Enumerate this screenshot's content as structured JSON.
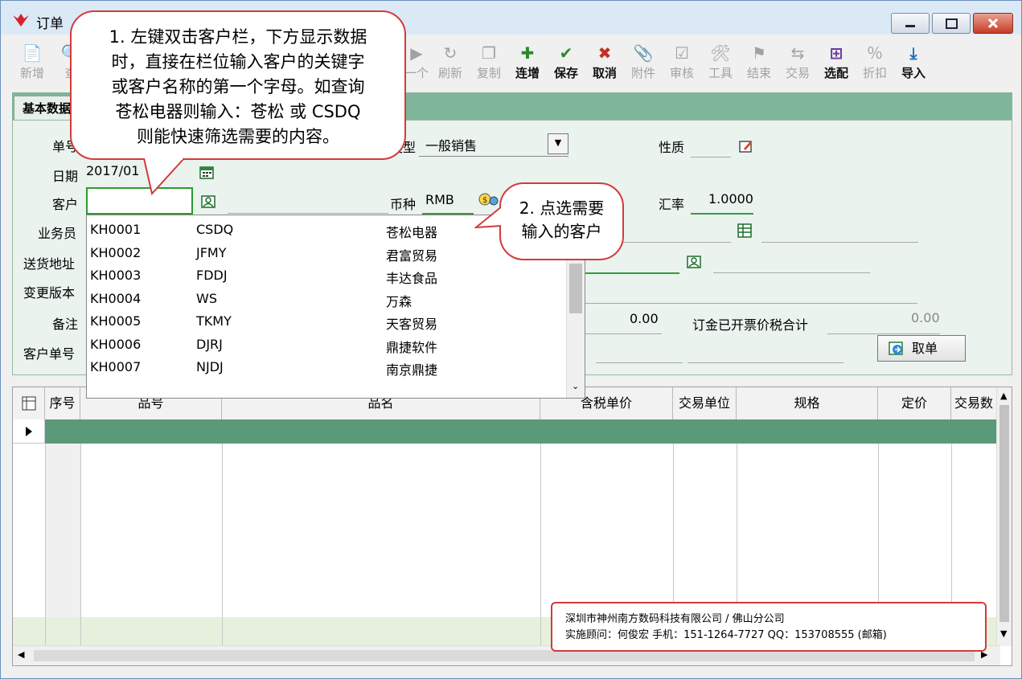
{
  "window": {
    "title": "订单"
  },
  "toolbar": [
    {
      "label": "新增",
      "icon": "📄",
      "enabled": false
    },
    {
      "label": "查",
      "icon": "🔍",
      "enabled": false
    },
    {
      "label": "一个",
      "icon": "▶",
      "enabled": false
    },
    {
      "label": "刷新",
      "icon": "↻",
      "enabled": false
    },
    {
      "label": "复制",
      "icon": "❐",
      "enabled": false
    },
    {
      "label": "连增",
      "icon": "✚",
      "enabled": true
    },
    {
      "label": "保存",
      "icon": "✔",
      "enabled": true
    },
    {
      "label": "取消",
      "icon": "✖",
      "enabled": true
    },
    {
      "label": "附件",
      "icon": "📎",
      "enabled": false
    },
    {
      "label": "审核",
      "icon": "☑",
      "enabled": false
    },
    {
      "label": "工具",
      "icon": "🛠",
      "enabled": false
    },
    {
      "label": "结束",
      "icon": "⚑",
      "enabled": false
    },
    {
      "label": "交易",
      "icon": "⇆",
      "enabled": false
    },
    {
      "label": "选配",
      "icon": "⊞",
      "enabled": true
    },
    {
      "label": "折扣",
      "icon": "％",
      "enabled": false
    },
    {
      "label": "导入",
      "icon": "⤓",
      "enabled": true
    }
  ],
  "tabs": [
    {
      "label": "基本数据"
    }
  ],
  "form": {
    "order_no_label": "单号",
    "date_label": "日期",
    "date_value": "2017/01",
    "customer_label": "客户",
    "customer_value": "",
    "salesman_label": "业务员",
    "address_label": "送货地址",
    "version_label": "变更版本",
    "remark_label": "备注",
    "cust_order_label": "客户单号",
    "type_label": "类型",
    "type_value": "一般销售",
    "nature_label": "性质",
    "currency_label": "币种",
    "currency_value": "RMB",
    "rate_label": "汇率",
    "rate_value": "1.0000",
    "amount_value": "0.00",
    "invoiced_label": "订金已开票价税合计",
    "invoiced_value": "0.00",
    "take_order_button": "取单"
  },
  "grid": {
    "columns": [
      "序号",
      "品号",
      "品名",
      "含税单价",
      "交易单位",
      "规格",
      "定价",
      "交易数"
    ]
  },
  "customer_dropdown": [
    {
      "code": "KH0001",
      "short": "CSDQ",
      "name": "苍松电器"
    },
    {
      "code": "KH0002",
      "short": "JFMY",
      "name": "君富贸易"
    },
    {
      "code": "KH0003",
      "short": "FDDJ",
      "name": "丰达食品"
    },
    {
      "code": "KH0004",
      "short": "WS",
      "name": "万森"
    },
    {
      "code": "KH0005",
      "short": "TKMY",
      "name": "天客贸易"
    },
    {
      "code": "KH0006",
      "short": "DJRJ",
      "name": "鼎捷软件"
    },
    {
      "code": "KH0007",
      "short": "NJDJ",
      "name": "南京鼎捷"
    }
  ],
  "callouts": {
    "c1": [
      "1. 左键双击客户栏，下方显示数据",
      "时，直接在栏位输入客户的关键字",
      "或客户名称的第一个字母。如查询",
      "苍松电器则输入：苍松 或 CSDQ",
      "则能快速筛选需要的内容。"
    ],
    "c2": [
      "2.  点选需要",
      "输入的客户"
    ]
  },
  "footer_info": {
    "line1": "深圳市神州南方数码科技有限公司 / 佛山分公司",
    "line2": "实施顾问：何俊宏  手机：151-1264-7727   QQ：153708555 (邮箱)"
  },
  "colors": {
    "accent": "#3a9a3a",
    "tabstrip": "#7fb69a",
    "callout_border": "#d23b3b",
    "selected_row": "#5a9a7a"
  }
}
